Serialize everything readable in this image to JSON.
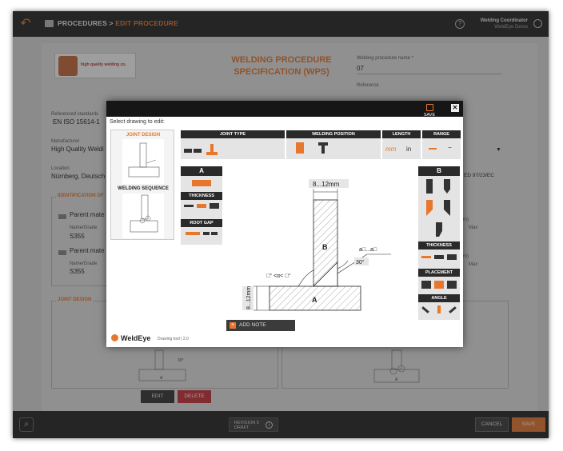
{
  "topbar": {
    "back_icon": "undo-icon",
    "crumb_root": "PROCEDURES",
    "crumb_sep": ">",
    "crumb_current": "EDIT PROCEDURE",
    "help_glyph": "?",
    "user_role": "Welding Coordinator",
    "user_org": "WeldEye Demo"
  },
  "form": {
    "logo_text": "high quality welding co.",
    "title_line1": "WELDING PROCEDURE",
    "title_line2": "SPECIFICATION (WPS)",
    "wps_name_label": "Welding procedure name *",
    "wps_name_value": "07",
    "reference_label": "Reference",
    "standards_label": "Referenced standards",
    "standards_value": "EN ISO 15614-1",
    "manufacturer_label": "Manufacturer",
    "manufacturer_value": "High Quality Weldi",
    "location_label": "Location",
    "location_value": "Nürnberg, Deutsch",
    "directive_value": "ED 97/23/EC",
    "identification_title": "IDENTIFICATION OF",
    "parent1_label": "Parent mate",
    "parent1_grade_label": "Name/Grade",
    "parent1_grade_value": "S355",
    "parent2_label": "Parent mate",
    "parent2_grade_label": "Name/Grade",
    "parent2_grade_value": "S355",
    "right_min_1": "m)",
    "right_max_1": "Max",
    "right_min_2": "m)",
    "right_max_2": "Max",
    "joint_design_title": "JOINT DESIGN",
    "edit_label": "EDIT",
    "delete_label": "DELETE"
  },
  "bottombar": {
    "attach_glyph": "⌕",
    "revision_line1": "REVISION 5",
    "revision_line2": "DRAFT",
    "info_glyph": "i",
    "cancel_label": "CANCEL",
    "save_label": "SAVE"
  },
  "modal": {
    "save_label": "SAVE",
    "close_glyph": "✕",
    "select_label": "Select drawing to edit:",
    "thumb1_title": "JOINT DESIGN",
    "thumb2_title": "WELDING SEQUENCE",
    "joint_type_label": "JOINT TYPE",
    "welding_position_label": "WELDING POSITION",
    "length_label": "LENGTH",
    "range_label": "RANGE",
    "length_mm": "mm",
    "length_in": "in",
    "range_minus": "−",
    "left_head": "A",
    "left_thickness": "THICKNESS",
    "left_root_gap": "ROOT GAP",
    "right_head": "B",
    "right_thickness": "THICKNESS",
    "right_placement": "PLACEMENT",
    "right_angle": "ANGLE",
    "dim_top": "8...12mm",
    "dim_side": "8...12mm",
    "label_b": "B",
    "label_a": "A",
    "throat": "a□...a□",
    "angle_30": "30°",
    "angle_alpha": "□° <α< □°",
    "add_note": "ADD NOTE",
    "add_note_glyph": "+",
    "brand": "WeldEye",
    "version": "Drawing tool | 2.0"
  },
  "colors": {
    "accent": "#e8772e",
    "dark": "#242424",
    "danger": "#c8313a"
  }
}
